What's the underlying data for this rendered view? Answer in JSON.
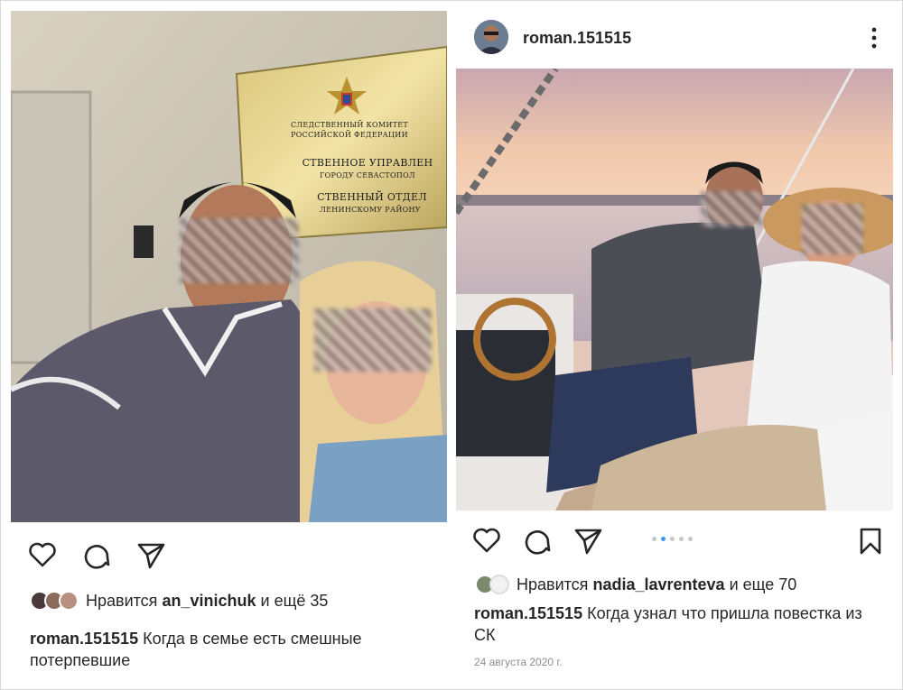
{
  "left_post": {
    "photo": {
      "sign": {
        "line1": "СЛЕДСТВЕННЫЙ КОМИТЕТ",
        "line2": "РОССИЙСКОЙ ФЕДЕРАЦИИ",
        "line3": "СТВЕННОЕ УПРАВЛЕН",
        "line4": "ГОРОДУ СЕВАСТОПОЛ",
        "line5": "СТВЕННЫЙ ОТДЕЛ",
        "line6": "ЛЕНИНСКОМУ РАЙОНУ"
      }
    },
    "likes": {
      "prefix": "Нравится",
      "user": "an_vinichuk",
      "suffix": "и ещё 35"
    },
    "caption": {
      "user": "roman.151515",
      "text": "Когда в семье есть смешные потерпевшие"
    }
  },
  "right_post": {
    "header": {
      "username": "roman.151515"
    },
    "carousel": {
      "count": 5,
      "active_index": 1
    },
    "likes": {
      "prefix": "Нравится",
      "user": "nadia_lavrenteva",
      "suffix": "и еще 70"
    },
    "caption": {
      "user": "roman.151515",
      "text": "Когда узнал что пришла повестка из СК"
    },
    "date": "24 августа 2020 г."
  },
  "icons": [
    "heart-icon",
    "comment-icon",
    "share-icon",
    "bookmark-icon",
    "more-icon"
  ],
  "colors": {
    "text": "#262626",
    "muted": "#8e8e8e",
    "carousel_active": "#3897f0",
    "carousel_inactive": "#c7c7c7"
  }
}
